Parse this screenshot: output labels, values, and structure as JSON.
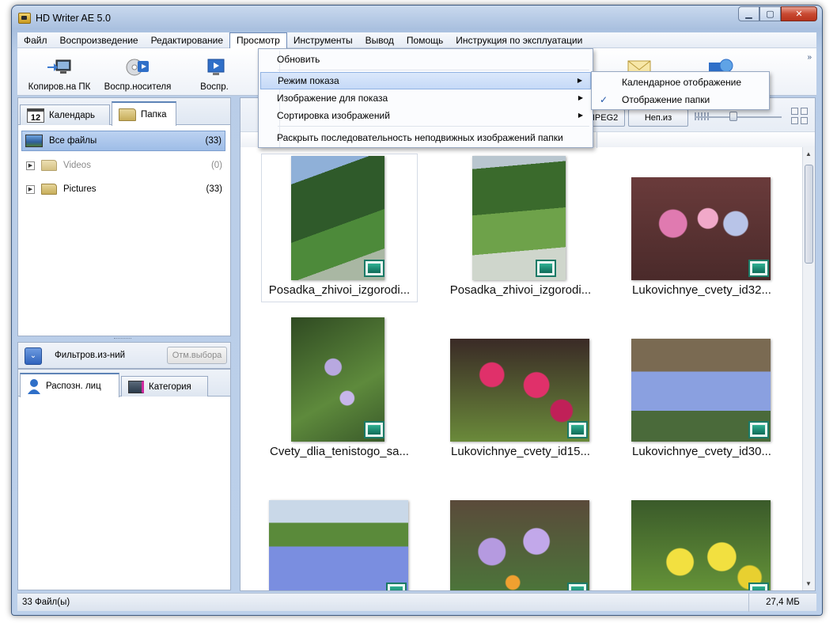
{
  "window": {
    "title": "HD Writer AE 5.0"
  },
  "menubar": [
    "Файл",
    "Воспроизведение",
    "Редактирование",
    "Просмотр",
    "Инструменты",
    "Вывод",
    "Помощь",
    "Инструкция по эксплуатации"
  ],
  "toolbar": {
    "buttons": [
      {
        "label": "Копиров.на ПК",
        "icon": "copy-to-pc-icon"
      },
      {
        "label": "Воспр.носителя",
        "icon": "media-playback-icon"
      },
      {
        "label": "Воспр.",
        "icon": "play-icon"
      }
    ],
    "overflow": "»"
  },
  "left_panel": {
    "tabs": [
      "Календарь",
      "Папка"
    ],
    "calendar_day": "12",
    "tree": [
      {
        "label": "Все файлы",
        "count": "(33)"
      },
      {
        "label": "Videos",
        "count": "(0)"
      },
      {
        "label": "Pictures",
        "count": "(33)"
      }
    ],
    "filter_label": "Фильтров.из-ний",
    "cancel_selection": "Отм.выбора",
    "bottom_tabs": [
      "Распозн. лиц",
      "Категория"
    ]
  },
  "main": {
    "header_buttons": [
      "MPEG2",
      "Неп.из"
    ],
    "thumbnails": [
      {
        "caption": "Posadka_zhivoi_izgorodi...",
        "palette": [
          "#2f5a2a",
          "#4d8a3a",
          "#a9b7a3"
        ]
      },
      {
        "caption": "Posadka_zhivoi_izgorodi...",
        "palette": [
          "#3a6a2c",
          "#6ea24a",
          "#cfd6cc"
        ]
      },
      {
        "caption": "Lukovichnye_cvety_id32...",
        "palette": [
          "#6a3b3b",
          "#e07ab0",
          "#b8c4e8"
        ]
      },
      {
        "caption": "Cvety_dlia_tenistogo_sa...",
        "palette": [
          "#2f4a22",
          "#5e8a3c",
          "#b8a8e0"
        ]
      },
      {
        "caption": "Lukovichnye_cvety_id15...",
        "palette": [
          "#3a2a26",
          "#e0306a",
          "#6a8a3a"
        ]
      },
      {
        "caption": "Lukovichnye_cvety_id30...",
        "palette": [
          "#7a6a52",
          "#8aa0e0",
          "#4a6a3a"
        ]
      },
      {
        "caption": "",
        "palette": [
          "#c9d8e8",
          "#7a8ee0",
          "#5a8a3a"
        ]
      },
      {
        "caption": "",
        "palette": [
          "#5a4a3a",
          "#b59ae0",
          "#4a7a3a"
        ]
      },
      {
        "caption": "",
        "palette": [
          "#3a5a2a",
          "#f2e040",
          "#6a9a3a"
        ]
      }
    ]
  },
  "menu_view": {
    "items": [
      {
        "label": "Обновить",
        "submenu": false
      },
      {
        "label": "Режим показа",
        "submenu": true
      },
      {
        "label": "Изображение для показа",
        "submenu": true
      },
      {
        "label": "Сортировка изображений",
        "submenu": true
      },
      {
        "label": "Раскрыть последовательность неподвижных изображений папки",
        "submenu": false
      }
    ],
    "arrow": "▶",
    "submenu_display_mode": [
      {
        "label": "Календарное отображение",
        "checked": false
      },
      {
        "label": "Отображение папки",
        "checked": true
      }
    ],
    "check_mark": "✓"
  },
  "statusbar": {
    "left": "33 Файл(ы)",
    "right": "27,4 МБ"
  },
  "colors": {
    "accent": "#5e84b7",
    "selection": "#9ebde7",
    "badge": "#1b7a66"
  }
}
